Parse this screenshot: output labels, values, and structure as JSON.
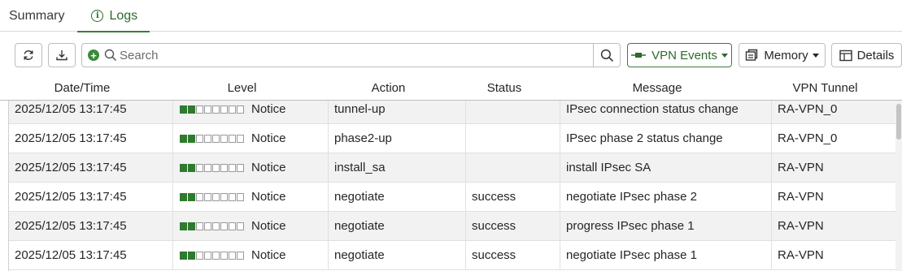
{
  "tabs": [
    {
      "label": "Summary",
      "active": false
    },
    {
      "label": "Logs",
      "active": true
    }
  ],
  "toolbar": {
    "search_placeholder": "Search",
    "vpn_events_label": "VPN Events",
    "memory_label": "Memory",
    "details_label": "Details"
  },
  "table": {
    "columns": [
      "Date/Time",
      "Level",
      "Action",
      "Status",
      "Message",
      "VPN Tunnel"
    ],
    "rows": [
      {
        "datetime": "2025/12/05 13:17:45",
        "level": "Notice",
        "level_bars": 2,
        "action": "tunnel-up",
        "status": "",
        "message": "IPsec connection status change",
        "tunnel": "RA-VPN_0"
      },
      {
        "datetime": "2025/12/05 13:17:45",
        "level": "Notice",
        "level_bars": 2,
        "action": "phase2-up",
        "status": "",
        "message": "IPsec phase 2 status change",
        "tunnel": "RA-VPN_0"
      },
      {
        "datetime": "2025/12/05 13:17:45",
        "level": "Notice",
        "level_bars": 2,
        "action": "install_sa",
        "status": "",
        "message": "install IPsec SA",
        "tunnel": "RA-VPN"
      },
      {
        "datetime": "2025/12/05 13:17:45",
        "level": "Notice",
        "level_bars": 2,
        "action": "negotiate",
        "status": "success",
        "message": "negotiate IPsec phase 2",
        "tunnel": "RA-VPN"
      },
      {
        "datetime": "2025/12/05 13:17:45",
        "level": "Notice",
        "level_bars": 2,
        "action": "negotiate",
        "status": "success",
        "message": "progress IPsec phase 1",
        "tunnel": "RA-VPN"
      },
      {
        "datetime": "2025/12/05 13:17:45",
        "level": "Notice",
        "level_bars": 2,
        "action": "negotiate",
        "status": "success",
        "message": "negotiate IPsec phase 1",
        "tunnel": "RA-VPN"
      }
    ]
  },
  "colors": {
    "accent": "#2d6a2d",
    "level_on": "#2f7a2f"
  },
  "icons": [
    "info-icon",
    "refresh-icon",
    "download-icon",
    "add-filter-icon",
    "search-icon",
    "vpn-icon",
    "memory-icon",
    "details-icon"
  ]
}
